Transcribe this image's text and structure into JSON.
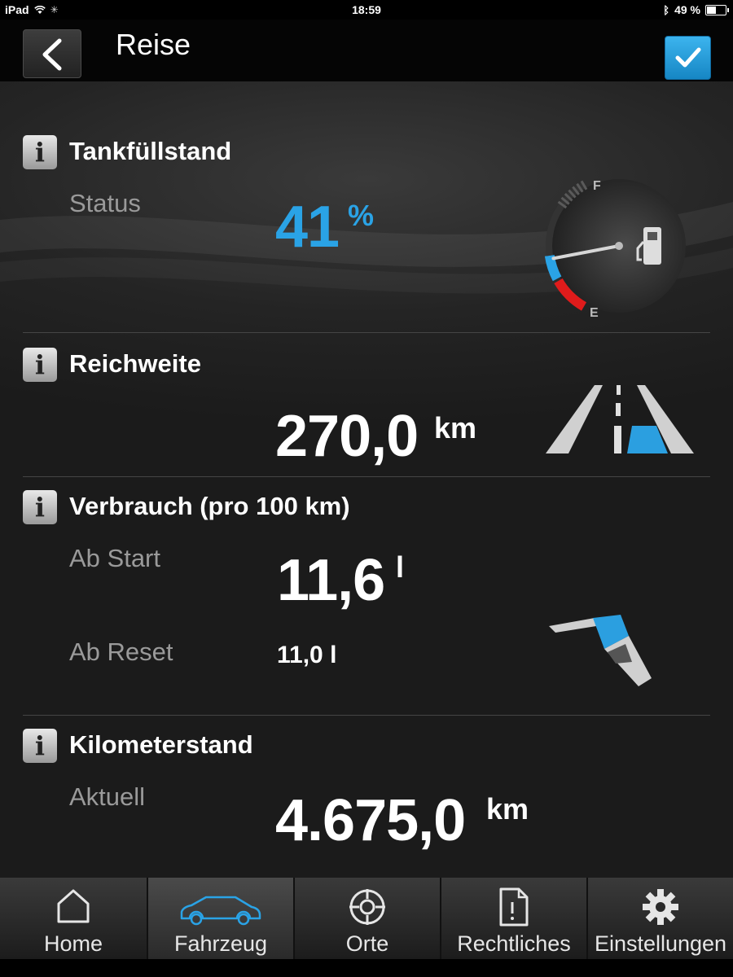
{
  "status_bar": {
    "device": "iPad",
    "time": "18:59",
    "battery": "49 %",
    "battery_level": 0.49
  },
  "nav": {
    "title": "Reise"
  },
  "sections": {
    "tank": {
      "title": "Tankfüllstand",
      "label": "Status",
      "value": "41",
      "unit": "%",
      "level": 0.41,
      "gauge_full": "F",
      "gauge_empty": "E"
    },
    "range": {
      "title": "Reichweite",
      "value": "270,0",
      "unit": "km"
    },
    "consumption": {
      "title": "Verbrauch (pro 100 km)",
      "start_label": "Ab Start",
      "start_value": "11,6",
      "start_unit": "l",
      "reset_label": "Ab Reset",
      "reset_value": "11,0 l"
    },
    "odometer": {
      "title": "Kilometerstand",
      "label": "Aktuell",
      "value": "4.675,0",
      "unit": "km"
    }
  },
  "tabs": [
    {
      "label": "Home",
      "icon": "home-icon"
    },
    {
      "label": "Fahrzeug",
      "icon": "car-icon",
      "active": true
    },
    {
      "label": "Orte",
      "icon": "crosshair-icon"
    },
    {
      "label": "Rechtliches",
      "icon": "document-icon"
    },
    {
      "label": "Einstellungen",
      "icon": "gear-icon"
    }
  ],
  "colors": {
    "accent": "#2aa3e6",
    "gauge_low": "#e01b1b"
  }
}
